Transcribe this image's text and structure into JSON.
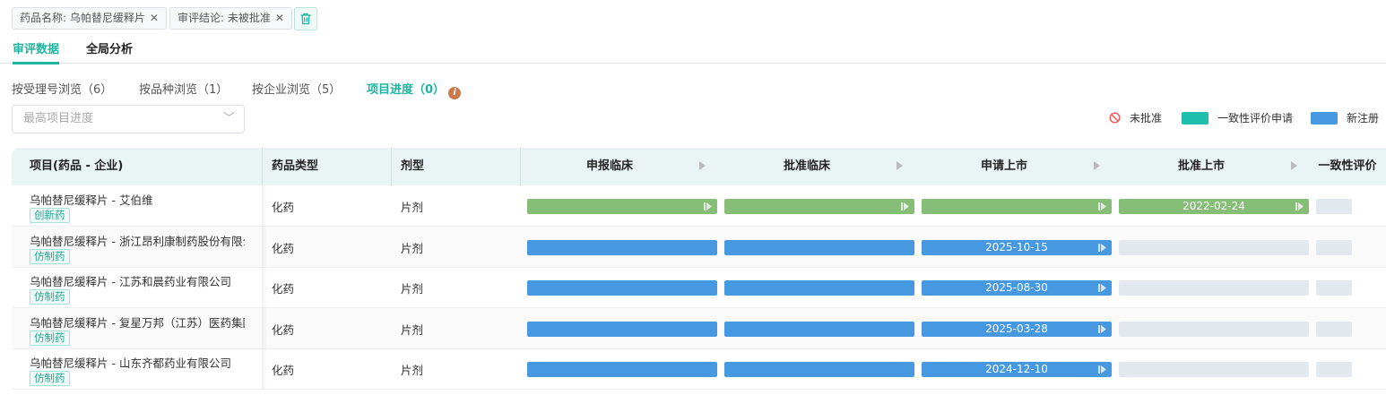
{
  "filters": [
    {
      "label": "药品名称: 乌帕替尼缓释片"
    },
    {
      "label": "审评结论: 未被批准"
    }
  ],
  "filter_close": "✕",
  "tabs": [
    {
      "label": "审评数据",
      "active": true
    },
    {
      "label": "全局分析",
      "active": false
    }
  ],
  "subtabs": [
    {
      "label": "按受理号浏览（6）"
    },
    {
      "label": "按品种浏览（1）"
    },
    {
      "label": "按企业浏览（5）"
    },
    {
      "label": "项目进度（0）",
      "active": true
    }
  ],
  "info_icon": "i",
  "select": {
    "placeholder": "最高项目进度",
    "chevron": "﹀"
  },
  "legend": [
    {
      "label": "未批准",
      "icon": "ban-icon",
      "color": "#f05a5a"
    },
    {
      "label": "一致性评价申请",
      "color": "#1fbfae"
    },
    {
      "label": "新注册",
      "color": "#4699e0"
    }
  ],
  "colors": {
    "accent": "#1fb5a0",
    "green": "#86bd77",
    "blue": "#4699e0",
    "empty": "#e3e8ee"
  },
  "table": {
    "headers": {
      "project": "项目(药品 - 企业)",
      "type": "药品类型",
      "form": "剂型"
    },
    "stages": [
      "申报临床",
      "批准临床",
      "申请上市",
      "批准上市",
      "一致性评价"
    ],
    "rows": [
      {
        "name": "乌帕替尼缓释片 - 艾伯维",
        "badge": "创新药",
        "type": "化药",
        "form": "片剂",
        "bars": [
          {
            "s": "green",
            "d": "",
            "a": true
          },
          {
            "s": "green",
            "d": "",
            "a": true
          },
          {
            "s": "green",
            "d": "",
            "a": true
          },
          {
            "s": "green",
            "d": "2022-02-24",
            "a": true
          },
          {
            "s": "empty",
            "d": "",
            "a": false
          }
        ]
      },
      {
        "name": "乌帕替尼缓释片 - 浙江昂利康制药股份有限公司",
        "badge": "仿制药",
        "type": "化药",
        "form": "片剂",
        "bars": [
          {
            "s": "blue",
            "d": "",
            "a": false
          },
          {
            "s": "blue",
            "d": "",
            "a": false
          },
          {
            "s": "blue",
            "d": "2025-10-15",
            "a": true
          },
          {
            "s": "empty",
            "d": "",
            "a": false
          },
          {
            "s": "empty",
            "d": "",
            "a": false
          }
        ]
      },
      {
        "name": "乌帕替尼缓释片 - 江苏和晨药业有限公司",
        "badge": "仿制药",
        "type": "化药",
        "form": "片剂",
        "bars": [
          {
            "s": "blue",
            "d": "",
            "a": false
          },
          {
            "s": "blue",
            "d": "",
            "a": false
          },
          {
            "s": "blue",
            "d": "2025-08-30",
            "a": true
          },
          {
            "s": "empty",
            "d": "",
            "a": false
          },
          {
            "s": "empty",
            "d": "",
            "a": false
          }
        ]
      },
      {
        "name": "乌帕替尼缓释片 - 复星万邦（江苏）医药集团有限公司",
        "badge": "仿制药",
        "type": "化药",
        "form": "片剂",
        "bars": [
          {
            "s": "blue",
            "d": "",
            "a": false
          },
          {
            "s": "blue",
            "d": "",
            "a": false
          },
          {
            "s": "blue",
            "d": "2025-03-28",
            "a": true
          },
          {
            "s": "empty",
            "d": "",
            "a": false
          },
          {
            "s": "empty",
            "d": "",
            "a": false
          }
        ]
      },
      {
        "name": "乌帕替尼缓释片 - 山东齐都药业有限公司",
        "badge": "仿制药",
        "type": "化药",
        "form": "片剂",
        "bars": [
          {
            "s": "blue",
            "d": "",
            "a": false
          },
          {
            "s": "blue",
            "d": "",
            "a": false
          },
          {
            "s": "blue",
            "d": "2024-12-10",
            "a": true
          },
          {
            "s": "empty",
            "d": "",
            "a": false
          },
          {
            "s": "empty",
            "d": "",
            "a": false
          }
        ]
      }
    ]
  }
}
